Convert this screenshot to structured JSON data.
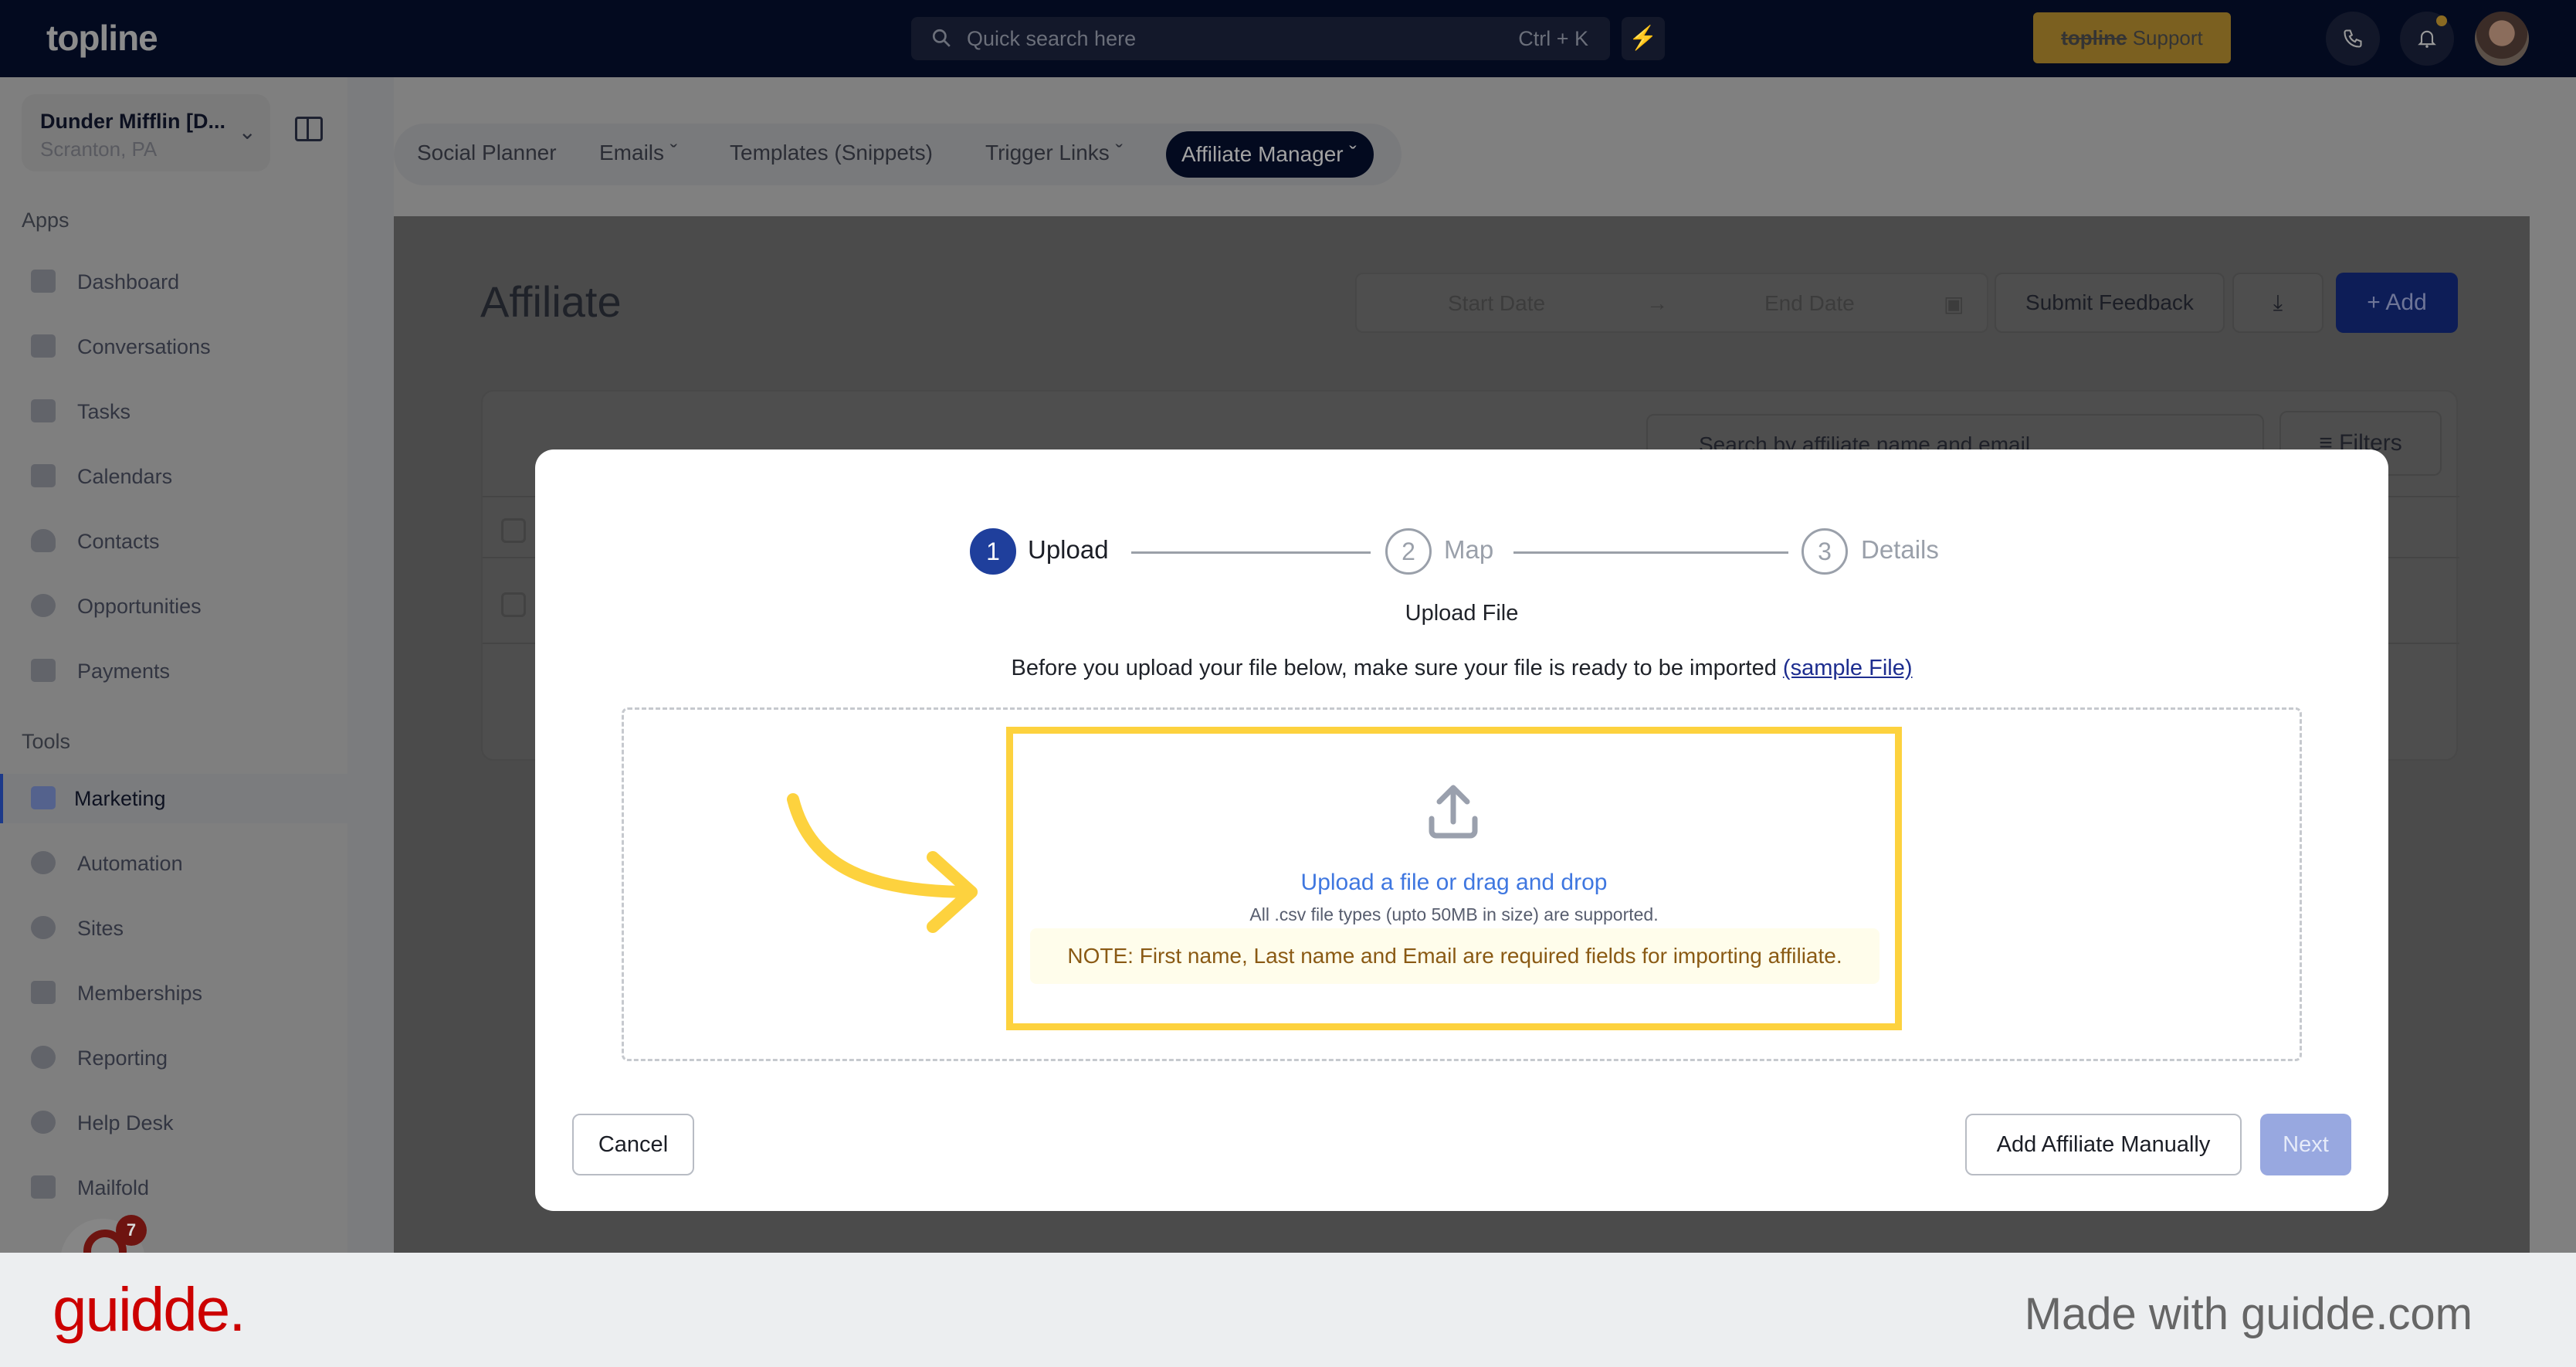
{
  "topbar": {
    "logo": "topline",
    "search_placeholder": "Quick search here",
    "search_shortcut": "Ctrl + K",
    "bolt_icon": "⚡",
    "support_brand": "topline",
    "support_label": "Support"
  },
  "sidebar": {
    "account_name": "Dunder Mifflin [D...",
    "account_location": "Scranton, PA",
    "apps_heading": "Apps",
    "apps": [
      {
        "label": "Dashboard",
        "icon": "dashboard-icon"
      },
      {
        "label": "Conversations",
        "icon": "chat-icon"
      },
      {
        "label": "Tasks",
        "icon": "task-icon"
      },
      {
        "label": "Calendars",
        "icon": "calendar-icon"
      },
      {
        "label": "Contacts",
        "icon": "contact-icon"
      },
      {
        "label": "Opportunities",
        "icon": "target-icon"
      },
      {
        "label": "Payments",
        "icon": "card-icon"
      }
    ],
    "tools_heading": "Tools",
    "tools": [
      {
        "label": "Marketing",
        "icon": "megaphone-icon",
        "active": true
      },
      {
        "label": "Automation",
        "icon": "gears-icon"
      },
      {
        "label": "Sites",
        "icon": "globe-icon"
      },
      {
        "label": "Memberships",
        "icon": "members-icon"
      },
      {
        "label": "Reporting",
        "icon": "pie-icon"
      },
      {
        "label": "Help Desk",
        "icon": "help-icon"
      },
      {
        "label": "Mailfold",
        "icon": "mail-icon"
      }
    ],
    "chat_badge": "7"
  },
  "subnav": {
    "tabs": [
      {
        "label": "Social Planner",
        "dropdown": false
      },
      {
        "label": "Emails",
        "dropdown": true
      },
      {
        "label": "Templates (Snippets)",
        "dropdown": false
      },
      {
        "label": "Trigger Links",
        "dropdown": true
      },
      {
        "label": "Affiliate Manager",
        "dropdown": true,
        "active": true
      }
    ]
  },
  "page": {
    "title": "Affiliate",
    "start_date_placeholder": "Start Date",
    "end_date_placeholder": "End Date",
    "submit_feedback": "Submit Feedback",
    "add_label": "+ Add",
    "table_search_placeholder": "Search by affiliate name and email",
    "filters_label": "Filters"
  },
  "modal": {
    "steps": [
      {
        "number": "1",
        "label": "Upload",
        "active": true
      },
      {
        "number": "2",
        "label": "Map",
        "active": false
      },
      {
        "number": "3",
        "label": "Details",
        "active": false
      }
    ],
    "title": "Upload File",
    "description": "Before you upload your file below, make sure your file is ready to be imported",
    "sample_link": "(sample File)",
    "upload_link": "Upload a file or drag and drop",
    "upload_hint": "All .csv file types (upto 50MB in size) are supported.",
    "note": "NOTE: First name, Last name and Email are required fields for importing affiliate.",
    "cancel_label": "Cancel",
    "add_manually_label": "Add Affiliate Manually",
    "next_label": "Next"
  },
  "footer": {
    "brand": "guidde.",
    "made_with": "Made with guidde.com"
  },
  "colors": {
    "highlight": "#fdd23e",
    "primary": "#1f3f9c",
    "link": "#3f77e0",
    "note_text": "#8a5a14",
    "brand_red": "#cc0000"
  }
}
